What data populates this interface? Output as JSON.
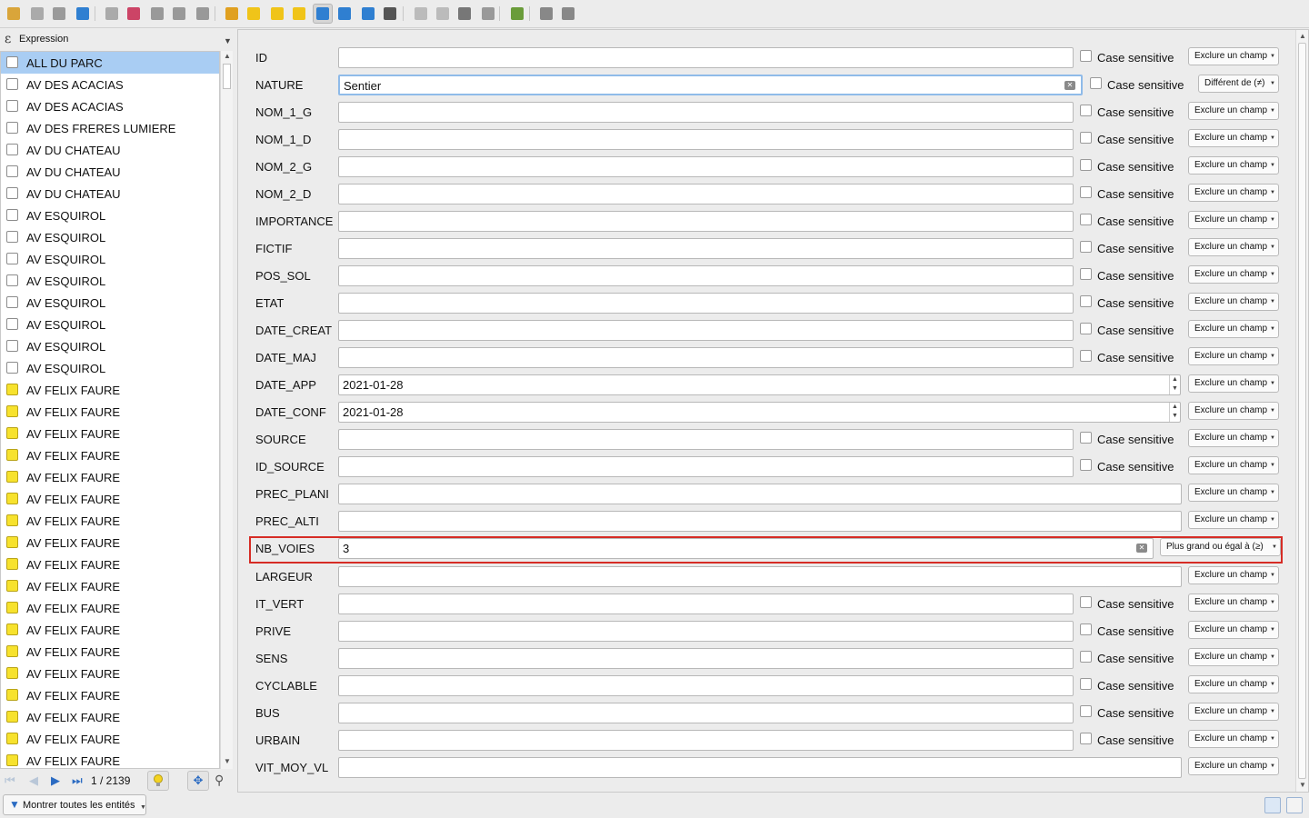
{
  "toolbar": {
    "icons": [
      "edit-pencil-icon",
      "save-edits-icon",
      "save-icon",
      "reload-icon",
      "add-feature-icon",
      "delete-feature-icon",
      "cut-icon",
      "copy-icon",
      "paste-icon",
      "expression-select-icon",
      "select-all-icon",
      "invert-selection-icon",
      "deselect-icon",
      "filter-form-icon",
      "move-selection-top-icon",
      "pan-to-selection-icon",
      "zoom-to-selection-icon",
      "new-field-icon",
      "delete-field-icon",
      "field-calculator-icon",
      "conditional-formatting-icon",
      "dock-icon",
      "actions-icon",
      "search-icon"
    ]
  },
  "left_panel": {
    "header_label": "Expression",
    "features": [
      {
        "label": "ALL DU PARC",
        "selected": true,
        "color": "white"
      },
      {
        "label": "AV DES ACACIAS",
        "color": "white"
      },
      {
        "label": "AV DES ACACIAS",
        "color": "white"
      },
      {
        "label": "AV DES FRERES LUMIERE",
        "color": "white"
      },
      {
        "label": "AV DU CHATEAU",
        "color": "white"
      },
      {
        "label": "AV DU CHATEAU",
        "color": "white"
      },
      {
        "label": "AV DU CHATEAU",
        "color": "white"
      },
      {
        "label": "AV ESQUIROL",
        "color": "white"
      },
      {
        "label": "AV ESQUIROL",
        "color": "white"
      },
      {
        "label": "AV ESQUIROL",
        "color": "white"
      },
      {
        "label": "AV ESQUIROL",
        "color": "white"
      },
      {
        "label": "AV ESQUIROL",
        "color": "white"
      },
      {
        "label": "AV ESQUIROL",
        "color": "white"
      },
      {
        "label": "AV ESQUIROL",
        "color": "white"
      },
      {
        "label": "AV ESQUIROL",
        "color": "white"
      },
      {
        "label": "AV FELIX FAURE",
        "color": "yellow"
      },
      {
        "label": "AV FELIX FAURE",
        "color": "yellow"
      },
      {
        "label": "AV FELIX FAURE",
        "color": "yellow"
      },
      {
        "label": "AV FELIX FAURE",
        "color": "yellow"
      },
      {
        "label": "AV FELIX FAURE",
        "color": "yellow"
      },
      {
        "label": "AV FELIX FAURE",
        "color": "yellow"
      },
      {
        "label": "AV FELIX FAURE",
        "color": "yellow"
      },
      {
        "label": "AV FELIX FAURE",
        "color": "yellow"
      },
      {
        "label": "AV FELIX FAURE",
        "color": "yellow"
      },
      {
        "label": "AV FELIX FAURE",
        "color": "yellow"
      },
      {
        "label": "AV FELIX FAURE",
        "color": "yellow"
      },
      {
        "label": "AV FELIX FAURE",
        "color": "yellow"
      },
      {
        "label": "AV FELIX FAURE",
        "color": "yellow"
      },
      {
        "label": "AV FELIX FAURE",
        "color": "yellow"
      },
      {
        "label": "AV FELIX FAURE",
        "color": "yellow"
      },
      {
        "label": "AV FELIX FAURE",
        "color": "yellow"
      },
      {
        "label": "AV FELIX FAURE",
        "color": "yellow"
      },
      {
        "label": "AV FELIX FAURE",
        "color": "yellow"
      }
    ],
    "nav_count": "1 / 2139",
    "show_all_label": "Montrer toutes les entités"
  },
  "form": {
    "case_label": "Case sensitive",
    "rows": [
      {
        "name": "ID",
        "value": "",
        "case": true,
        "mode": "Exclure un champ"
      },
      {
        "name": "NATURE",
        "value": "Sentier",
        "case": true,
        "mode": "Différent de (≠)",
        "focus": true,
        "clear": true
      },
      {
        "name": "NOM_1_G",
        "value": "",
        "case": true,
        "mode": "Exclure un champ"
      },
      {
        "name": "NOM_1_D",
        "value": "",
        "case": true,
        "mode": "Exclure un champ"
      },
      {
        "name": "NOM_2_G",
        "value": "",
        "case": true,
        "mode": "Exclure un champ"
      },
      {
        "name": "NOM_2_D",
        "value": "",
        "case": true,
        "mode": "Exclure un champ"
      },
      {
        "name": "IMPORTANCE",
        "value": "",
        "case": true,
        "mode": "Exclure un champ"
      },
      {
        "name": "FICTIF",
        "value": "",
        "case": true,
        "mode": "Exclure un champ"
      },
      {
        "name": "POS_SOL",
        "value": "",
        "case": true,
        "mode": "Exclure un champ"
      },
      {
        "name": "ETAT",
        "value": "",
        "case": true,
        "mode": "Exclure un champ"
      },
      {
        "name": "DATE_CREAT",
        "value": "",
        "case": true,
        "mode": "Exclure un champ"
      },
      {
        "name": "DATE_MAJ",
        "value": "",
        "case": true,
        "mode": "Exclure un champ"
      },
      {
        "name": "DATE_APP",
        "value": "2021-01-28",
        "case": false,
        "mode": "Exclure un champ",
        "spin": true
      },
      {
        "name": "DATE_CONF",
        "value": "2021-01-28",
        "case": false,
        "mode": "Exclure un champ",
        "spin": true
      },
      {
        "name": "SOURCE",
        "value": "",
        "case": true,
        "mode": "Exclure un champ"
      },
      {
        "name": "ID_SOURCE",
        "value": "",
        "case": true,
        "mode": "Exclure un champ"
      },
      {
        "name": "PREC_PLANI",
        "value": "",
        "case": false,
        "mode": "Exclure un champ"
      },
      {
        "name": "PREC_ALTI",
        "value": "",
        "case": false,
        "mode": "Exclure un champ"
      },
      {
        "name": "NB_VOIES",
        "value": "3",
        "case": false,
        "mode": "Plus grand ou égal à (≥)",
        "clear": true,
        "highlight": true
      },
      {
        "name": "LARGEUR",
        "value": "",
        "case": false,
        "mode": "Exclure un champ"
      },
      {
        "name": "IT_VERT",
        "value": "",
        "case": true,
        "mode": "Exclure un champ"
      },
      {
        "name": "PRIVE",
        "value": "",
        "case": true,
        "mode": "Exclure un champ"
      },
      {
        "name": "SENS",
        "value": "",
        "case": true,
        "mode": "Exclure un champ"
      },
      {
        "name": "CYCLABLE",
        "value": "",
        "case": true,
        "mode": "Exclure un champ"
      },
      {
        "name": "BUS",
        "value": "",
        "case": true,
        "mode": "Exclure un champ"
      },
      {
        "name": "URBAIN",
        "value": "",
        "case": true,
        "mode": "Exclure un champ"
      },
      {
        "name": "VIT_MOY_VL",
        "value": "",
        "case": false,
        "mode": "Exclure un champ"
      }
    ]
  },
  "colors": {
    "selection": "#a9cdf3",
    "highlight_border": "#d62c25",
    "feature_yellow": "#f7e22d"
  }
}
